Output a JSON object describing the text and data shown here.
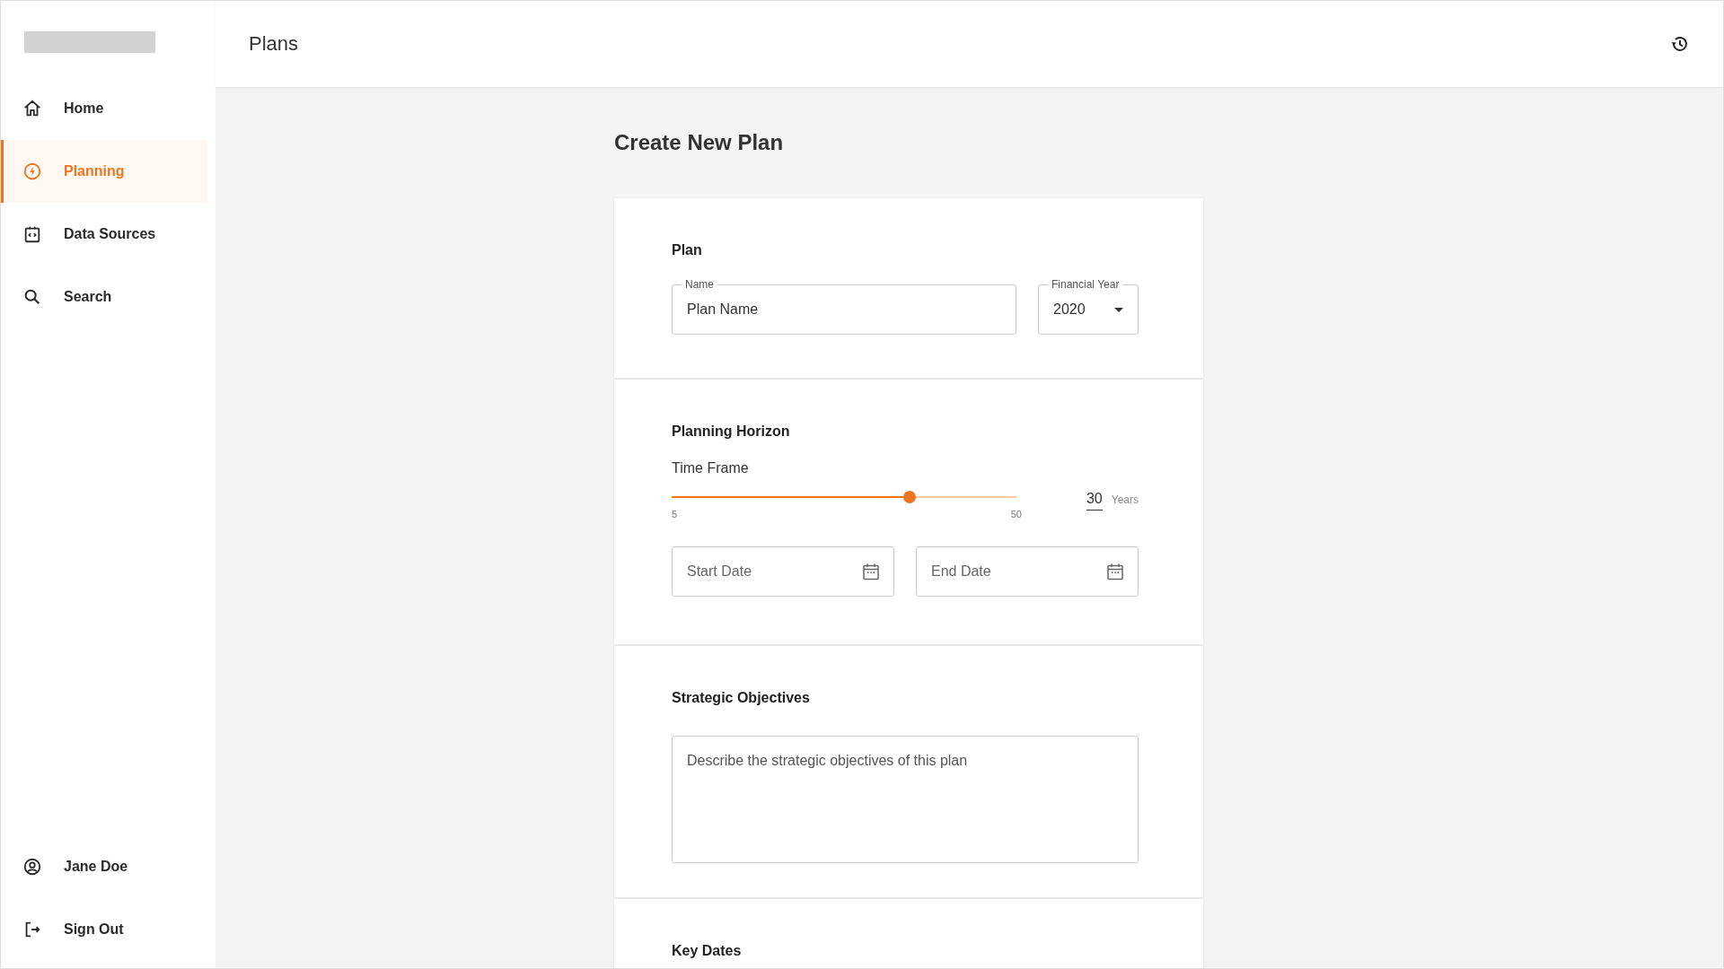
{
  "header": {
    "title": "Plans"
  },
  "sidebar": {
    "items": [
      {
        "label": "Home",
        "selected": false
      },
      {
        "label": "Planning",
        "selected": true
      },
      {
        "label": "Data Sources",
        "selected": false
      },
      {
        "label": "Search",
        "selected": false
      }
    ],
    "footer_items": [
      {
        "label": "Jane Doe"
      },
      {
        "label": "Sign Out"
      }
    ]
  },
  "page_title": "Create New Plan",
  "plan": {
    "heading": "Plan",
    "name_field": {
      "label": "Name",
      "placeholder": "Plan Name"
    },
    "year_field": {
      "label": "Financial Year",
      "value": "2020"
    }
  },
  "horizon": {
    "heading": "Planning Horizon",
    "time_frame": {
      "label": "Time Frame",
      "level": 0.69,
      "min": "5",
      "max": "50",
      "value": "30",
      "unit": "Years"
    },
    "start_date": {
      "placeholder": "Start Date"
    },
    "end_date": {
      "placeholder": "End Date"
    }
  },
  "objectives": {
    "heading": "Strategic Objectives",
    "placeholder": "Describe the strategic objectives of this plan"
  },
  "key_dates": {
    "heading": "Key Dates"
  }
}
